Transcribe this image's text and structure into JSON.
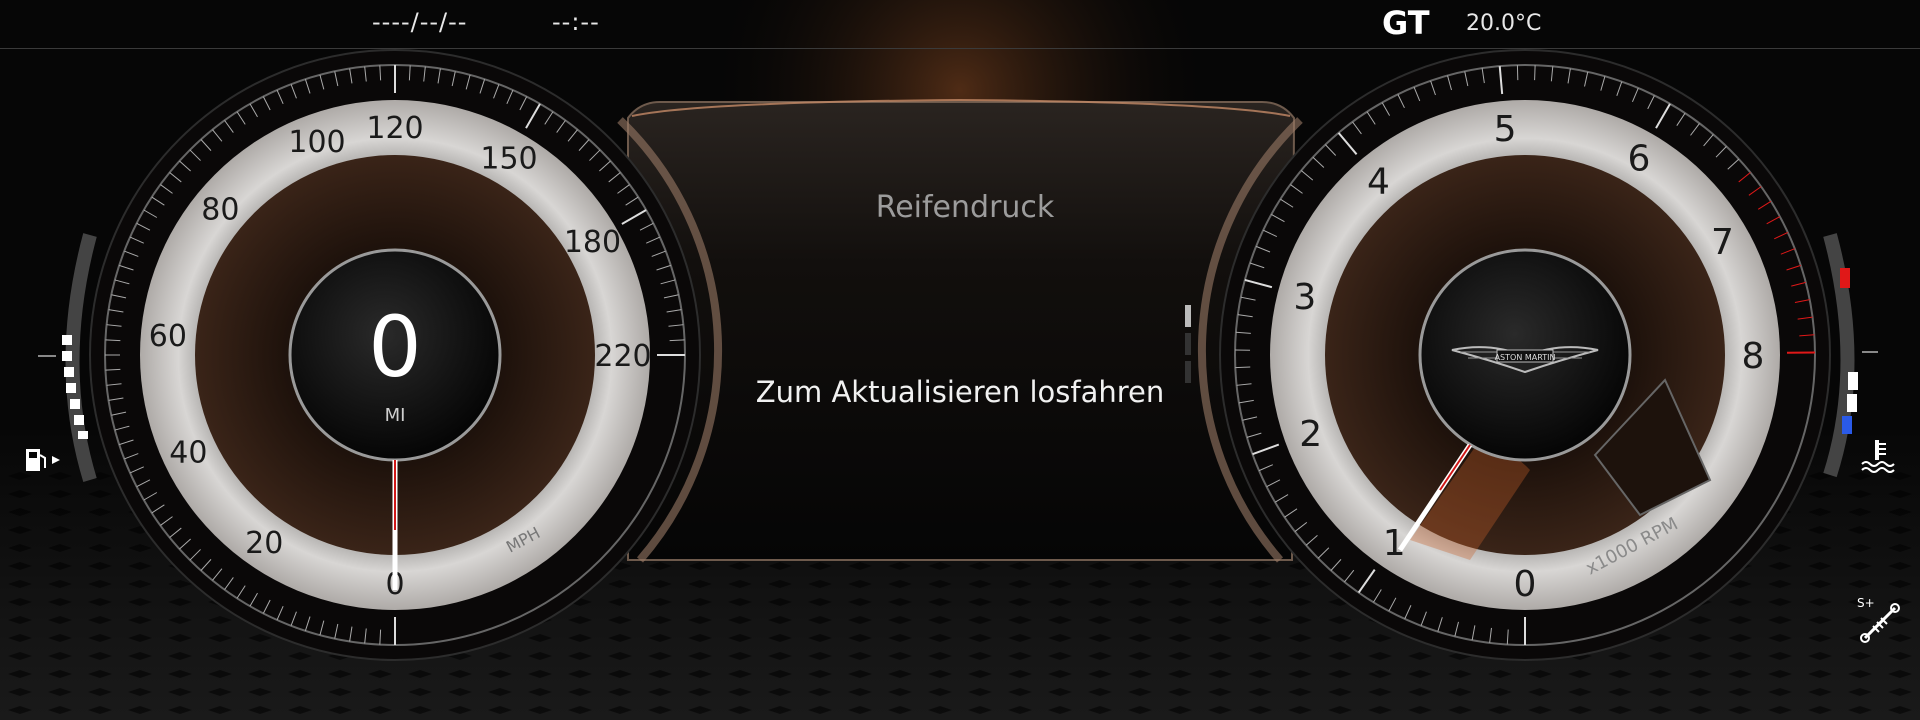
{
  "header": {
    "date": "----/--/--",
    "time": "--:--",
    "drive_mode": "GT",
    "outside_temp": "20.0°C"
  },
  "info_panel": {
    "title": "Reifendruck",
    "message": "Zum Aktualisieren losfahren"
  },
  "speedometer": {
    "value": "0",
    "odometer_unit": "MI",
    "unit_label": "MPH",
    "scale_labels": [
      "0",
      "20",
      "40",
      "60",
      "80",
      "100",
      "120",
      "150",
      "180",
      "220"
    ]
  },
  "tachometer": {
    "unit_label": "x1000 RPM",
    "scale_labels": [
      "0",
      "1",
      "2",
      "3",
      "4",
      "5",
      "6",
      "7",
      "8"
    ],
    "brand": "ASTON MARTIN",
    "redline_start": 7
  },
  "fuel_gauge": {
    "icon": "fuel-pump-icon",
    "level_fraction": 0.4
  },
  "coolant_gauge": {
    "icon": "coolant-temp-icon",
    "level_fraction": 0.45
  },
  "suspension": {
    "icon": "suspension-sport-plus-icon",
    "label": "S+"
  },
  "colors": {
    "accent": "#c8622a",
    "redline": "#e01818",
    "cold": "#2a5ae8"
  }
}
